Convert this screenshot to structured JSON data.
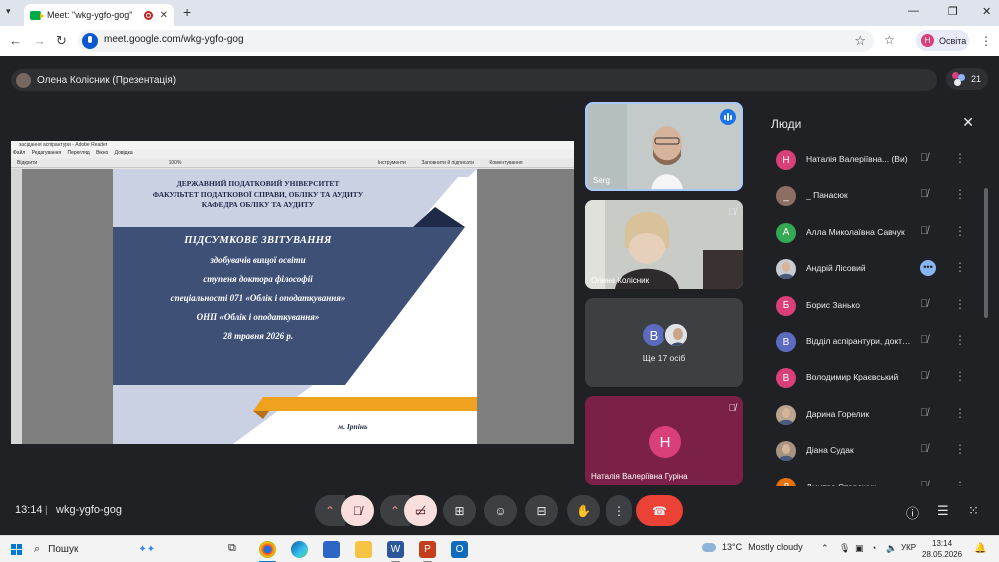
{
  "browser": {
    "tab_title": "Meet: \"wkg-ygfo-gog\"",
    "tab_close": "✕",
    "new_tab": "+",
    "url": "meet.google.com/wkg-ygfo-gog",
    "profile_initial": "Н",
    "profile_name": "Освіта",
    "win_min": "—",
    "win_restore": "❐",
    "win_close": "✕"
  },
  "meet": {
    "presenter": "Олена Колісник (Презентація)",
    "participant_count": "21",
    "time": "13:14",
    "separator": "|",
    "meeting_code": "wkg-ygfo-gog"
  },
  "reader": {
    "title": "засідання аспірантури - Adobe Reader",
    "menu": [
      "Файл",
      "Редагування",
      "Перегляд",
      "Вікно",
      "Довідка"
    ],
    "open_label": "Відкрити",
    "zoom": "100%",
    "tools": "Інструменти",
    "sign": "Заповнити й підписати",
    "comment": "Коментування"
  },
  "slide": {
    "header": [
      "ДЕРЖАВНИЙ ПОДАТКОВИЙ УНІВЕРСИТЕТ",
      "ФАКУЛЬТЕТ ПОДАТКОВОЇ СПРАВИ, ОБЛІКУ ТА АУДИТУ",
      "КАФЕДРА ОБЛІКУ ТА АУДИТУ"
    ],
    "body": [
      "ПІДСУМКОВЕ ЗВІТУВАННЯ",
      "здобувачів вищої освіти",
      "ступеня доктора філософії",
      "спеціальності 071 «Облік і оподаткування»",
      "ОНП «Облік і оподаткування»",
      "28 травня 2026 р."
    ],
    "city": "м. Ірпінь",
    "colors": {
      "navy": "#3f5077",
      "light": "#c9d1e3",
      "gold": "#f0a11e"
    }
  },
  "tiles": [
    {
      "name": "Serg"
    },
    {
      "name": "Олена Колісник"
    },
    {
      "initial": "В",
      "label": "Ще 17 осіб"
    },
    {
      "initial": "Н",
      "name": "Наталія Валеріївна Гуріна"
    }
  ],
  "people": {
    "title": "Люди",
    "close": "✕",
    "list": [
      {
        "initial": "Н",
        "color": "#d93f78",
        "name": "Наталія Валеріївна... (Ви)"
      },
      {
        "initial": "_",
        "color": "#8d6e63",
        "name": "_ Панасюк"
      },
      {
        "initial": "А",
        "color": "#34a853",
        "name": "Алла Миколаївна Савчук"
      },
      {
        "initial": "",
        "color": "#c8ccd2",
        "name": "Андрій Лісовий"
      },
      {
        "initial": "Б",
        "color": "#d93f78",
        "name": "Борис Занько"
      },
      {
        "initial": "В",
        "color": "#5c6bc0",
        "name": "Відділ аспірантури, докторантури"
      },
      {
        "initial": "В",
        "color": "#d93f78",
        "name": "Володимир Краєвський"
      },
      {
        "initial": "",
        "color": "#b9a58f",
        "name": "Дарина Горелик"
      },
      {
        "initial": "",
        "color": "#a89382",
        "name": "Діана Судак"
      },
      {
        "initial": "Д",
        "color": "#e8710a",
        "name": "Дмитро Сторожук"
      }
    ]
  },
  "taskbar": {
    "search": "Пошук",
    "temp": "13°C",
    "weather": "Mostly cloudy",
    "lang": "УКР",
    "time": "13:14",
    "date": "28.05.2026"
  },
  "colors": {
    "meet_bg": "#202124",
    "end_call": "#ea4335",
    "accent_blue": "#1a73e8"
  }
}
